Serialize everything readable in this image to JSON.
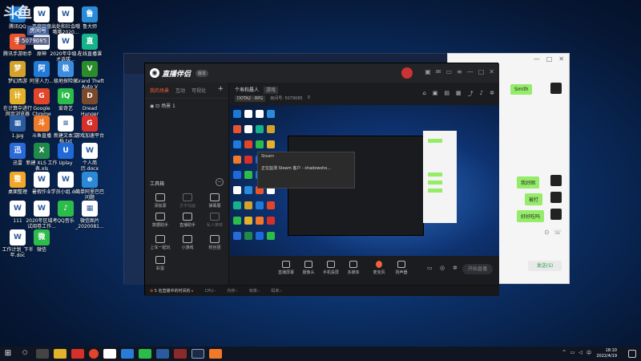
{
  "watermark": {
    "logo": "斗鱼",
    "badge": "房间号",
    "room": "5079085"
  },
  "desktop_icons": [
    {
      "label": "腾讯QQ",
      "color": "#1e7ad0",
      "glyph": "Q"
    },
    {
      "label": "百度网盘",
      "color": "#ffffff",
      "glyph": "W"
    },
    {
      "label": "出处和社会哦哦哦2020...",
      "color": "#ffffff",
      "glyph": "W"
    },
    {
      "label": "鲁大师",
      "color": "#2a8cd8",
      "glyph": "鲁"
    },
    {
      "label": "腾讯手游助手",
      "color": "#e8542c",
      "glyph": "手"
    },
    {
      "label": "原神",
      "color": "#ffffff",
      "glyph": "W"
    },
    {
      "label": "2020年中级人才选拔...",
      "color": "#ffffff",
      "glyph": "W"
    },
    {
      "label": "在线直播课",
      "color": "#16b28a",
      "glyph": "直"
    },
    {
      "label": "梦幻西游",
      "color": "#d4a12a",
      "glyph": "梦"
    },
    {
      "label": "阿里人力...",
      "color": "#1f7ad8",
      "glyph": "阿"
    },
    {
      "label": "极地探险家",
      "color": "#3c8de0",
      "glyph": "极"
    },
    {
      "label": "Grand Theft Auto V",
      "color": "#2b8c2b",
      "glyph": "V"
    },
    {
      "label": "在计算中进行网页浏览器",
      "color": "#e3b22a",
      "glyph": "计"
    },
    {
      "label": "Google Chrome",
      "color": "#e3452b",
      "glyph": "G"
    },
    {
      "label": "爱奇艺",
      "color": "#2cbc4a",
      "glyph": "iQ"
    },
    {
      "label": "Dread Hunger",
      "color": "#7a4a2a",
      "glyph": "D"
    },
    {
      "label": "1.jpg",
      "color": "#2a5aa0",
      "glyph": "▦"
    },
    {
      "label": "斗鱼直播",
      "color": "#f07a2a",
      "glyph": "斗"
    },
    {
      "label": "新建文本文档.txt",
      "color": "#ffffff",
      "glyph": "≡"
    },
    {
      "label": "游戏加速平台",
      "color": "#d6302a",
      "glyph": "G"
    },
    {
      "label": "迅雷",
      "color": "#2a6ad8",
      "glyph": "迅"
    },
    {
      "label": "新建 XLS 工作表.xls",
      "color": "#1f8a4a",
      "glyph": "X"
    },
    {
      "label": "Uplay",
      "color": "#1f6ad8",
      "glyph": "U"
    },
    {
      "label": "个人简历.docx",
      "color": "#ffffff",
      "glyph": "W"
    },
    {
      "label": "桌面整理",
      "color": "#f0a72a",
      "glyph": "整"
    },
    {
      "label": "暑假作业",
      "color": "#ffffff",
      "glyph": "W"
    },
    {
      "label": "学员小组.doc",
      "color": "#ffffff",
      "glyph": "W"
    },
    {
      "label": "简单阿里巴巴问题",
      "color": "#2a8ad8",
      "glyph": "e"
    },
    {
      "label": "111",
      "color": "#ffffff",
      "glyph": "W"
    },
    {
      "label": "2020年区域考试阅卷工作...",
      "color": "#ffffff",
      "glyph": "W"
    },
    {
      "label": "QQ音乐",
      "color": "#2cbc4a",
      "glyph": "♪"
    },
    {
      "label": "微信图片_2020081...",
      "color": "#ffffff",
      "glyph": "▦"
    },
    {
      "label": "工作计划_下半年.doc",
      "color": "#ffffff",
      "glyph": "W"
    },
    {
      "label": "微信",
      "color": "#2cbc4a",
      "glyph": "微"
    }
  ],
  "app": {
    "name": "直播伴侣",
    "version": "版本",
    "left_tabs": [
      "我的场景",
      "互动",
      "可视化"
    ],
    "scene_label": "场景 1",
    "tools_header": "工具箱",
    "tools": [
      {
        "label": "添加源",
        "dim": false
      },
      {
        "label": "文字动画",
        "dim": true
      },
      {
        "label": "弹幕展",
        "dim": false
      },
      {
        "label": "数据助手",
        "dim": false
      },
      {
        "label": "直播助手",
        "dim": false
      },
      {
        "label": "私人推荐",
        "dim": true
      },
      {
        "label": "上车一起玩",
        "dim": false
      },
      {
        "label": "小游戏",
        "dim": false
      },
      {
        "label": "粉丝团",
        "dim": false
      },
      {
        "label": "彩蛋",
        "dim": false
      }
    ],
    "stream_title": "个寿和晨人",
    "stream_tag": "游戏",
    "category": "DOTA2 · RPG",
    "room_info": "房间号: 5079085",
    "online": "0",
    "popup_title": "Steam",
    "popup_body": "正在监测 Steam 客户 - shadowsho...",
    "bottom_tools": [
      "直播屏幕",
      "摄像头",
      "手机投屏",
      "多媒体",
      "麦克风",
      "扬声器"
    ],
    "start_button": "开始直播",
    "status_warning": "5 名直播中的时间的",
    "status_items": [
      "CPU:-",
      "内存:-",
      "帧率:-",
      "码率:-"
    ]
  },
  "chat": {
    "messages": [
      "Smith",
      "我好困",
      "被打",
      "好好吃吗"
    ],
    "send_label": "发送(S)"
  },
  "taskbar": {
    "start_glyph": "⊞",
    "tray_lang": "中",
    "time": "18:10",
    "date": "2022/4/19"
  }
}
